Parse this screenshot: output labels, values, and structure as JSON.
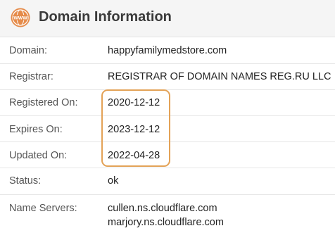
{
  "header": {
    "title": "Domain Information",
    "icon": "www-globe-icon",
    "icon_text": "WWW",
    "icon_color": "#e58b4a"
  },
  "rows": [
    {
      "label": "Domain:",
      "value": "happyfamilymedstore.com"
    },
    {
      "label": "Registrar:",
      "value": "REGISTRAR OF DOMAIN NAMES REG.RU LLC"
    },
    {
      "label": "Registered On:",
      "value": "2020-12-12"
    },
    {
      "label": "Expires On:",
      "value": "2023-12-12"
    },
    {
      "label": "Updated On:",
      "value": "2022-04-28"
    },
    {
      "label": "Status:",
      "value": "ok"
    },
    {
      "label": "Name Servers:",
      "values": [
        "cullen.ns.cloudflare.com",
        "marjory.ns.cloudflare.com"
      ]
    }
  ],
  "highlight": {
    "color": "#e3a257",
    "covers": [
      "Registered On:",
      "Expires On:",
      "Updated On:"
    ]
  }
}
